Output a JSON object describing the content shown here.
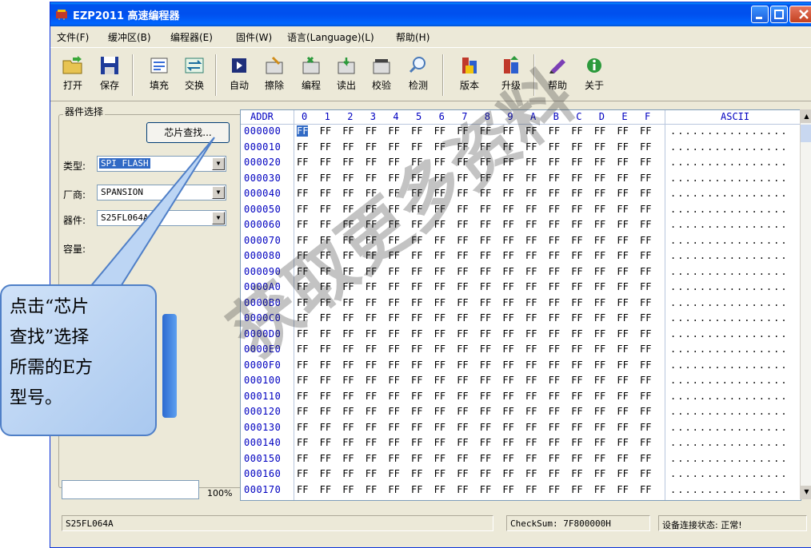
{
  "window": {
    "title": "EZP2011 高速编程器",
    "title_bar_color": "#0054e3"
  },
  "menu": [
    "文件(F)",
    "缓冲区(B)",
    "编程器(E)",
    "固件(W)",
    "语言(Language)(L)",
    "帮助(H)"
  ],
  "toolbar": [
    {
      "label": "打开",
      "icon": "open-folder-icon"
    },
    {
      "label": "保存",
      "icon": "floppy-save-icon"
    },
    {
      "label": "填充",
      "icon": "fill-icon"
    },
    {
      "label": "交换",
      "icon": "swap-icon"
    },
    {
      "label": "自动",
      "icon": "auto-icon"
    },
    {
      "label": "擦除",
      "icon": "erase-icon"
    },
    {
      "label": "编程",
      "icon": "program-icon"
    },
    {
      "label": "读出",
      "icon": "read-icon"
    },
    {
      "label": "校验",
      "icon": "verify-icon"
    },
    {
      "label": "检测",
      "icon": "detect-icon"
    },
    {
      "label": "版本",
      "icon": "version-icon"
    },
    {
      "label": "升级",
      "icon": "upgrade-icon"
    },
    {
      "label": "帮助",
      "icon": "help-icon"
    },
    {
      "label": "关于",
      "icon": "about-icon"
    }
  ],
  "device_panel": {
    "group_title": "器件选择",
    "find_chip_button": "芯片查找...",
    "type_label": "类型:",
    "type_value": "SPI FLASH",
    "vendor_label": "厂商:",
    "vendor_value": "SPANSION",
    "device_label": "器件:",
    "device_value": "S25FL064A",
    "capacity_label": "容量:",
    "progress_percent": "100%",
    "progress_fraction": 1.0
  },
  "hex_view": {
    "addr_header": "ADDR",
    "column_headers": [
      "0",
      "1",
      "2",
      "3",
      "4",
      "5",
      "6",
      "7",
      "8",
      "9",
      "A",
      "B",
      "C",
      "D",
      "E",
      "F"
    ],
    "ascii_header": "ASCII",
    "addresses": [
      "000000",
      "000010",
      "000020",
      "000030",
      "000040",
      "000050",
      "000060",
      "000070",
      "000080",
      "000090",
      "0000A0",
      "0000B0",
      "0000C0",
      "0000D0",
      "0000E0",
      "0000F0",
      "000100",
      "000110",
      "000120",
      "000130",
      "000140",
      "000150",
      "000160",
      "000170"
    ],
    "byte_value": "FF",
    "ascii_value": "................"
  },
  "status_bar": {
    "device": "S25FL064A",
    "checksum": "CheckSum: 7F800000H",
    "connection": "设备连接状态: 正常!"
  },
  "callout": {
    "lines": [
      "点击“芯片",
      "查找”选择",
      "所需的E方",
      "型号。"
    ]
  },
  "watermark": "获取更多资料"
}
